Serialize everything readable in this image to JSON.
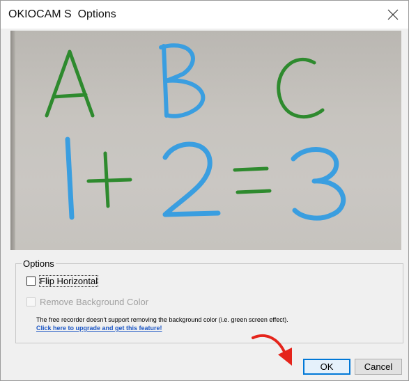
{
  "window": {
    "title": "OKIOCAM S  Options",
    "close_icon": "close-icon"
  },
  "preview": {
    "handwriting": [
      "A",
      "B",
      "C",
      "1+2=3"
    ]
  },
  "options": {
    "group_label": "Options",
    "flip_horizontal": {
      "label": "Flip Horizontal",
      "checked": false
    },
    "remove_background": {
      "label": "Remove Background Color",
      "checked": false,
      "enabled": false
    },
    "note": "The free recorder doesn't support removing the background color (i.e. green screen effect).",
    "upgrade_link": "Click here to upgrade and get this feature!"
  },
  "buttons": {
    "ok": "OK",
    "cancel": "Cancel"
  },
  "colors": {
    "link": "#1a55c4",
    "accent": "#0078d7",
    "annotation_arrow": "#e5241b",
    "marker_green": "#2e8a2e",
    "marker_blue": "#3a9ee0"
  }
}
